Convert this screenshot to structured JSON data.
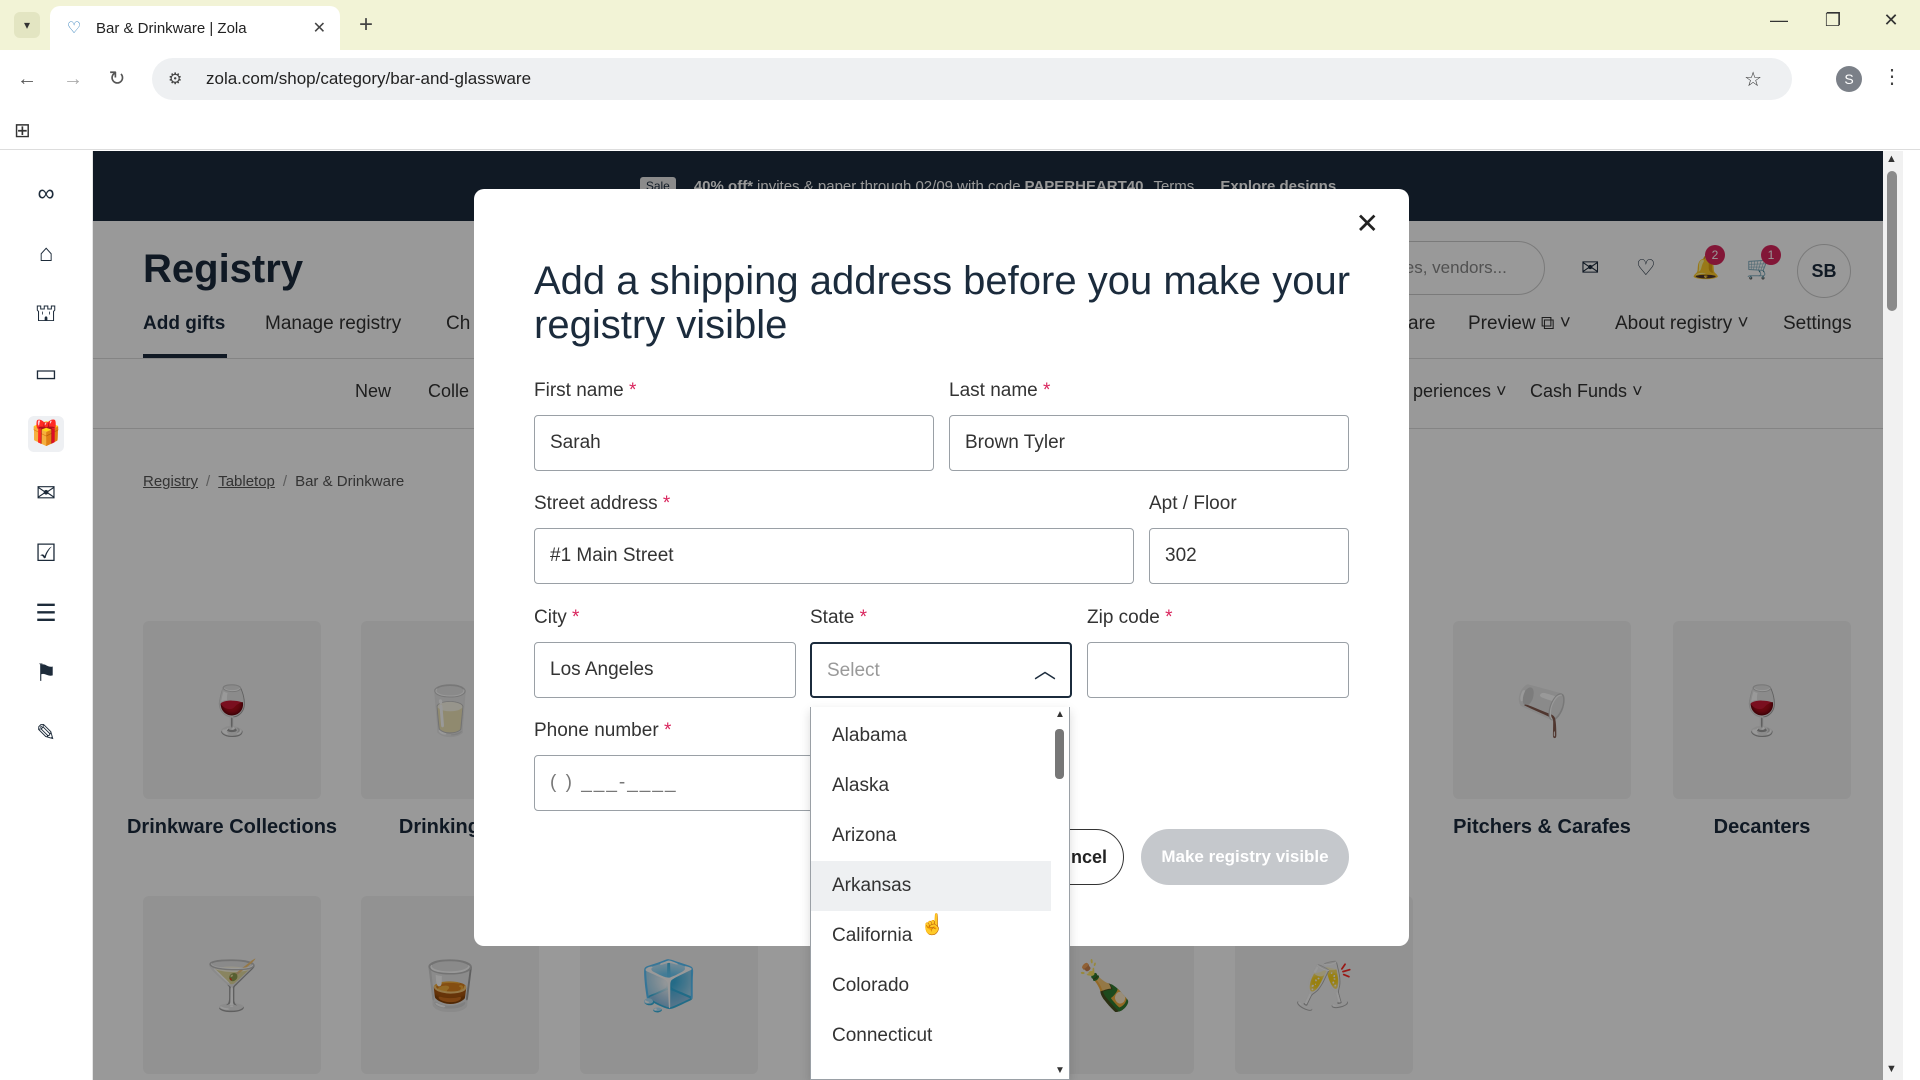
{
  "browser": {
    "tab_title": "Bar & Drinkware | Zola",
    "url": "zola.com/shop/category/bar-and-glassware",
    "profile_initial": "S"
  },
  "promo": {
    "badge": "Sale",
    "text_bold": "40% off*",
    "text": "invites & paper through 02/09 with code",
    "code": "PAPERHEART40",
    "terms": "Terms",
    "link": "Explore designs"
  },
  "header": {
    "title": "Registry",
    "search_placeholder": "les, vendors...",
    "notifications_count": "2",
    "cart_count": "1",
    "avatar_initials": "SB"
  },
  "subnav": {
    "add_gifts": "Add gifts",
    "manage_registry": "Manage registry",
    "checklist": "Ch",
    "share": "are",
    "preview": "Preview",
    "about": "About registry",
    "settings": "Settings"
  },
  "catnav": {
    "new": "New",
    "collections": "Colle",
    "experiences": "periences",
    "cash_funds": "Cash Funds"
  },
  "breadcrumb": {
    "registry": "Registry",
    "tabletop": "Tabletop",
    "current": "Bar & Drinkware"
  },
  "categories": {
    "drinkware_collections": "Drinkware Collections",
    "drinking_glasses": "Drinking G",
    "pitchers": "Pitchers & Carafes",
    "decanters": "Decanters"
  },
  "modal": {
    "title": "Add a shipping address before you make your registry visible",
    "first_name_label": "First name",
    "first_name_value": "Sarah",
    "last_name_label": "Last name",
    "last_name_value": "Brown Tyler",
    "street_label": "Street address",
    "street_value": "#1 Main Street",
    "apt_label": "Apt / Floor",
    "apt_value": "302",
    "city_label": "City",
    "city_value": "Los Angeles",
    "state_label": "State",
    "state_placeholder": "Select",
    "zip_label": "Zip code",
    "zip_value": "",
    "phone_label": "Phone number",
    "phone_mask": "(    )  ___-____",
    "required_mark": "*",
    "cancel_label": "ncel",
    "make_visible_label": "Make registry visible"
  },
  "state_options": [
    "Alabama",
    "Alaska",
    "Arizona",
    "Arkansas",
    "California",
    "Colorado",
    "Connecticut"
  ],
  "hovered_option": "Arkansas"
}
